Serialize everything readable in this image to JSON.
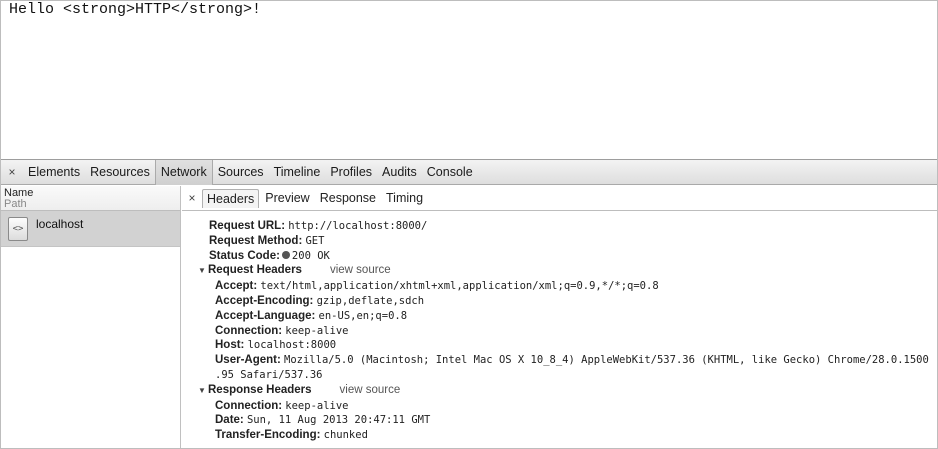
{
  "page": {
    "content": "Hello <strong>HTTP</strong>!"
  },
  "devtools": {
    "close_glyph": "×",
    "panels": [
      "Elements",
      "Resources",
      "Network",
      "Sources",
      "Timeline",
      "Profiles",
      "Audits",
      "Console"
    ],
    "active_panel": "Network",
    "columns": {
      "name": "Name",
      "path": "Path"
    },
    "requests": [
      {
        "name": "localhost",
        "icon": "<>"
      }
    ],
    "detail_tabs": [
      "Headers",
      "Preview",
      "Response",
      "Timing"
    ],
    "active_detail_tab": "Headers",
    "general": {
      "request_url_key": "Request URL:",
      "request_url": "http://localhost:8000/",
      "request_method_key": "Request Method:",
      "request_method": "GET",
      "status_code_key": "Status Code:",
      "status_code": "200 OK"
    },
    "request_headers": {
      "title": "Request Headers",
      "view_source": "view source",
      "items": [
        {
          "key": "Accept:",
          "value": "text/html,application/xhtml+xml,application/xml;q=0.9,*/*;q=0.8"
        },
        {
          "key": "Accept-Encoding:",
          "value": "gzip,deflate,sdch"
        },
        {
          "key": "Accept-Language:",
          "value": "en-US,en;q=0.8"
        },
        {
          "key": "Connection:",
          "value": "keep-alive"
        },
        {
          "key": "Host:",
          "value": "localhost:8000"
        },
        {
          "key": "User-Agent:",
          "value": "Mozilla/5.0 (Macintosh; Intel Mac OS X 10_8_4) AppleWebKit/537.36 (KHTML, like Gecko) Chrome/28.0.1500",
          "continuation": ".95 Safari/537.36"
        }
      ]
    },
    "response_headers": {
      "title": "Response Headers",
      "view_source": "view source",
      "items": [
        {
          "key": "Connection:",
          "value": "keep-alive"
        },
        {
          "key": "Date:",
          "value": "Sun, 11 Aug 2013 20:47:11 GMT"
        },
        {
          "key": "Transfer-Encoding:",
          "value": "chunked"
        }
      ]
    }
  }
}
